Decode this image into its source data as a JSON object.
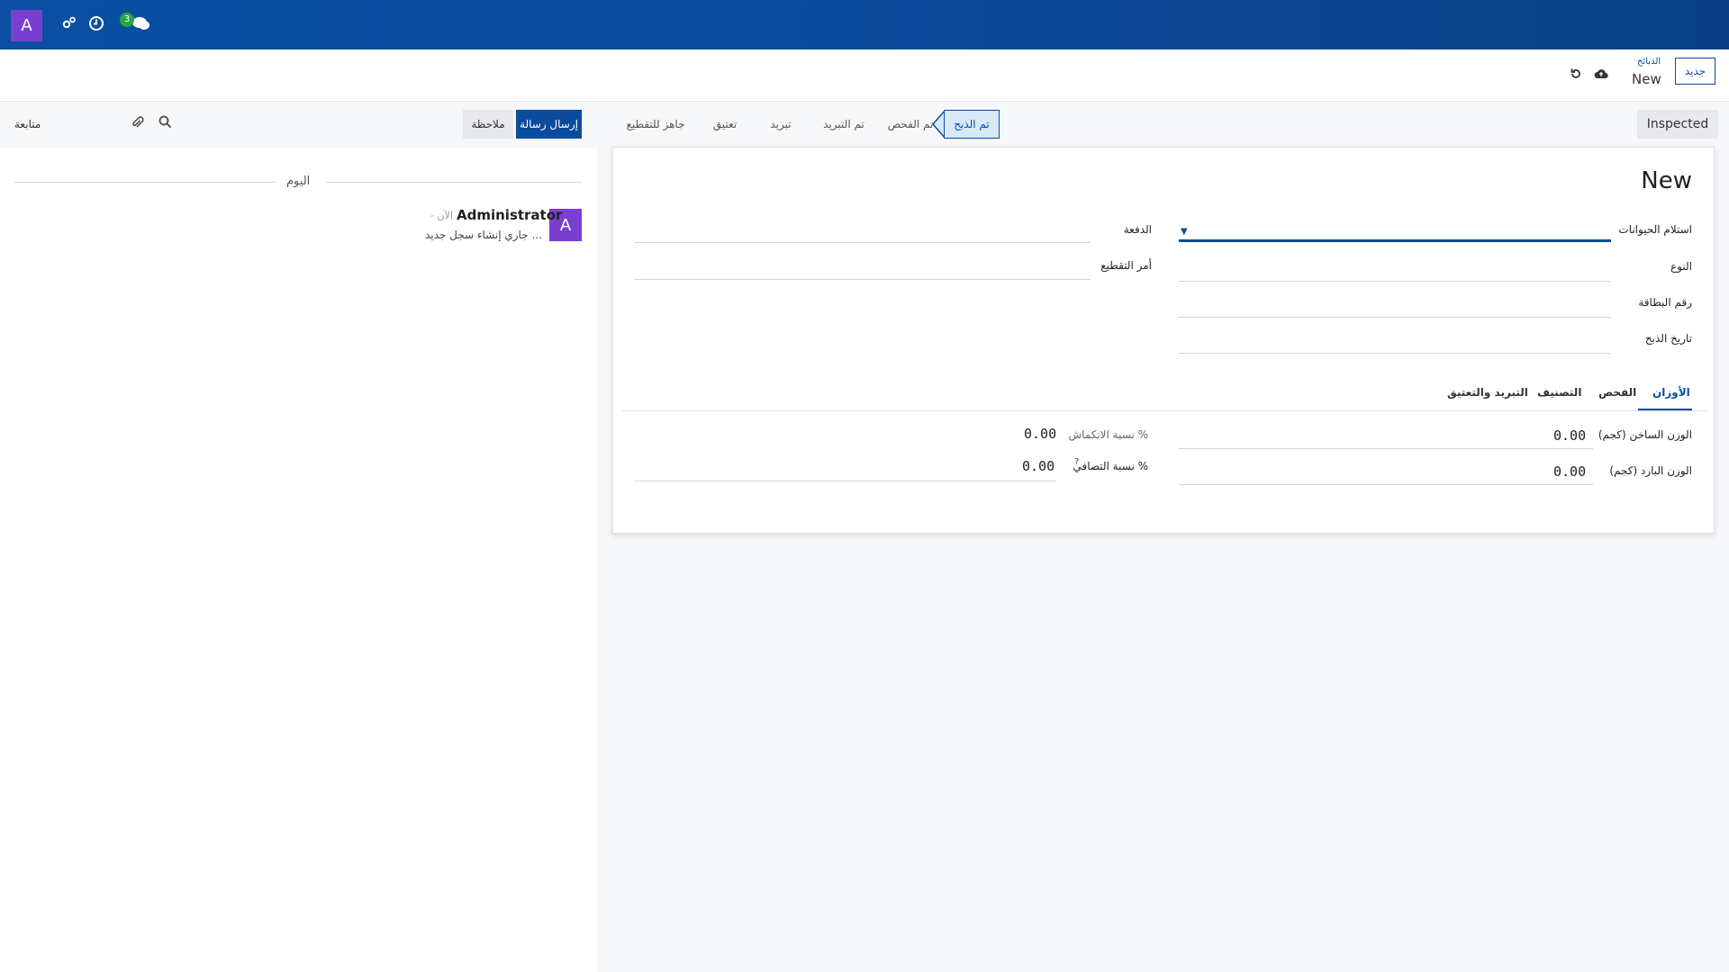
{
  "navbar": {
    "avatar_letter": "A",
    "icons": [
      "gears-icon",
      "clock-icon",
      "chat-icon"
    ],
    "message_count": "3"
  },
  "control_panel": {
    "new_button_label": "جديد",
    "breadcrumb_parent": "الذبائح",
    "breadcrumb_current": "New",
    "save_icon": "cloud-upload-icon",
    "discard_icon": "undo-icon"
  },
  "chatter": {
    "send_message_label": "إرسال رسالة",
    "log_note_label": "ملاحظة",
    "follow_label": "متابعة",
    "date_separator": "اليوم",
    "message": {
      "avatar_letter": "A",
      "author": "Administrator",
      "time": "- الآن",
      "body": "جاري إنشاء سجل جديد ..."
    }
  },
  "statusbar": {
    "status_button_label": "Inspected",
    "stages": [
      "تم الذبح",
      "تم الفحص",
      "تم التبريد",
      "تبريد",
      "تعتيق",
      "جاهز للتقطيع"
    ],
    "active_stage_index": 0
  },
  "form": {
    "title": "New",
    "fields_right": [
      {
        "label": "استلام الحيوانات",
        "value": ""
      },
      {
        "label": "النوع",
        "value": ""
      },
      {
        "label": "رقم البطاقة",
        "value": ""
      },
      {
        "label": "تاريخ الذبح",
        "value": ""
      }
    ],
    "fields_left": [
      {
        "label": "الدفعة",
        "value": ""
      },
      {
        "label": "أمر التقطيع",
        "value": ""
      }
    ],
    "tabs": [
      "الأوزان",
      "الفحص",
      "التصنيف",
      "التبريد والتعتيق"
    ],
    "active_tab_index": 0,
    "weights": {
      "hot_weight_label": "الوزن الساخن (كجم)",
      "hot_weight_value": "0.00",
      "cold_weight_label": "الوزن البارد (كجم)",
      "cold_weight_value": "0.00",
      "shrink_label": "نسبة الانكماش %",
      "shrink_value": "0.00",
      "net_label": "نسبة التصافي %",
      "net_value": "0.00",
      "help_mark": "?"
    }
  }
}
